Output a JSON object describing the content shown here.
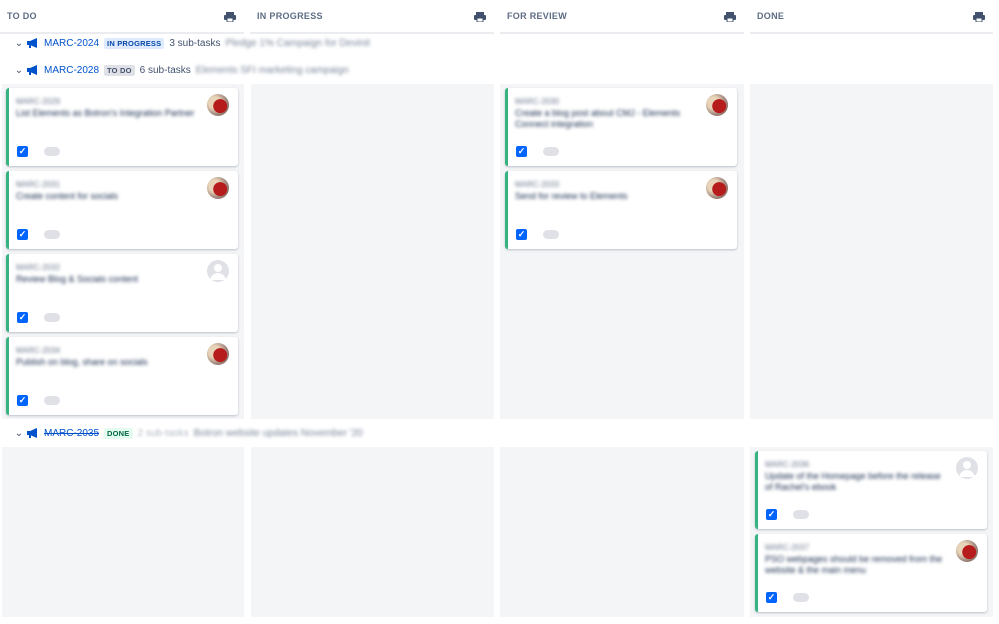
{
  "columns": [
    {
      "label": "TO DO"
    },
    {
      "label": "IN PROGRESS"
    },
    {
      "label": "FOR REVIEW"
    },
    {
      "label": "DONE"
    }
  ],
  "epics": [
    {
      "key": "MARC-2024",
      "status": "IN PROGRESS",
      "subtasks": "3 sub-tasks",
      "summary": "Pledge 1% Campaign for Devinit"
    },
    {
      "key": "MARC-2028",
      "status": "TO DO",
      "subtasks": "6 sub-tasks",
      "summary": "Elements SFI marketing campaign"
    },
    {
      "key": "MARC-2035",
      "status": "DONE",
      "subtasks": "2 sub-tasks",
      "summary": "Botron website updates November '20"
    }
  ],
  "cards": {
    "todo": [
      {
        "key": "MARC-2029",
        "summary": "List Elements as Botron's Integration Partner",
        "avatar": "photo-avatar"
      },
      {
        "key": "MARC-2031",
        "summary": "Create content for socials",
        "avatar": "photo-avatar"
      },
      {
        "key": "MARC-2032",
        "summary": "Review Blog & Socials content",
        "avatar": "default-avatar"
      },
      {
        "key": "MARC-2034",
        "summary": "Publish on blog, share on socials",
        "avatar": "photo-avatar"
      }
    ],
    "review": [
      {
        "key": "MARC-2030",
        "summary": "Create a blog post about CMJ - Elements Connect integration",
        "avatar": "photo-avatar"
      },
      {
        "key": "MARC-2033",
        "summary": "Send for review to Elements",
        "avatar": "photo-avatar"
      }
    ],
    "done": [
      {
        "key": "MARC-2036",
        "summary": "Update of the Homepage before the release of Rachel's ebook",
        "avatar": "default-avatar"
      },
      {
        "key": "MARC-2037",
        "summary": "PSO webpages should be removed from the website & the main menu",
        "avatar": "photo-avatar"
      }
    ]
  },
  "colors": {
    "accent": "#0052cc",
    "card_border": "#36b37e",
    "checkbox": "#0065ff",
    "lane_background": "#f4f5f7"
  },
  "icons": {
    "print": "printer-icon",
    "epic": "megaphone-icon",
    "toggle": "chevron-down-icon",
    "checkbox": "checkbox-icon"
  }
}
